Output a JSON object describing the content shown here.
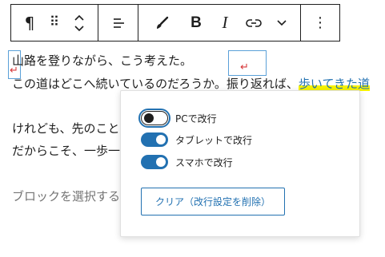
{
  "toolbar": {
    "paragraph_icon": "¶",
    "drag_icon": "⠿",
    "align_icon": "align-left",
    "brush_icon": "brush",
    "bold_label": "B",
    "italic_label": "I",
    "link_icon": "link",
    "more_rich_icon": "chevron-down",
    "options_icon": "⋮"
  },
  "content": {
    "line1": "山路を登りながら、こう考えた。",
    "line2_plain": "この道はどこへ続いているのだろうか。振り返れば、",
    "line2_link": "歩いてきた道",
    "line3": "けれども、先のこと",
    "line4": "だからこそ、一歩一",
    "placeholder": "ブロックを選択する",
    "line_break_mark": "↵"
  },
  "popover": {
    "toggles": [
      {
        "label": "PCで改行",
        "checked": false
      },
      {
        "label": "タブレットで改行",
        "checked": true
      },
      {
        "label": "スマホで改行",
        "checked": true
      }
    ],
    "clear_label": "クリア（改行設定を削除）"
  },
  "colors": {
    "accent": "#2271b1",
    "highlight": "#f7f300",
    "break_mark": "#d63638"
  }
}
